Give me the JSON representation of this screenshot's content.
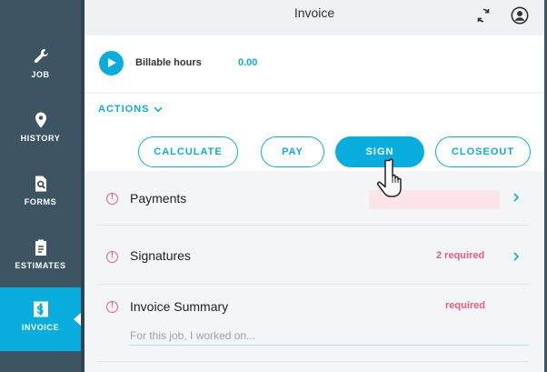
{
  "sidebar": {
    "items": [
      {
        "label": "JOB",
        "icon": "wrench-icon"
      },
      {
        "label": "HISTORY",
        "icon": "map-pin-icon"
      },
      {
        "label": "FORMS",
        "icon": "form-search-icon"
      },
      {
        "label": "ESTIMATES",
        "icon": "clipboard-icon"
      },
      {
        "label": "INVOICE",
        "icon": "invoice-dollar-icon",
        "active": true
      }
    ]
  },
  "header": {
    "title": "Invoice",
    "icons": [
      "sync-icon",
      "account-icon"
    ]
  },
  "hours": {
    "label": "Billable hours",
    "value": "0.00"
  },
  "actions": {
    "toggle_label": "ACTIONS",
    "buttons": {
      "calculate": "CALCULATE",
      "pay": "PAY",
      "sign": "SIGN",
      "closeout": "CLOSEOUT"
    }
  },
  "sections": {
    "payments": {
      "label": "Payments"
    },
    "signatures": {
      "label": "Signatures",
      "status": "2 required"
    },
    "summary": {
      "label": "Invoice Summary",
      "status": "required",
      "placeholder": "For this job, I worked on..."
    }
  },
  "colors": {
    "accent": "#0aaede",
    "sidebar": "#3d5562",
    "alert": "#e85d7e"
  }
}
